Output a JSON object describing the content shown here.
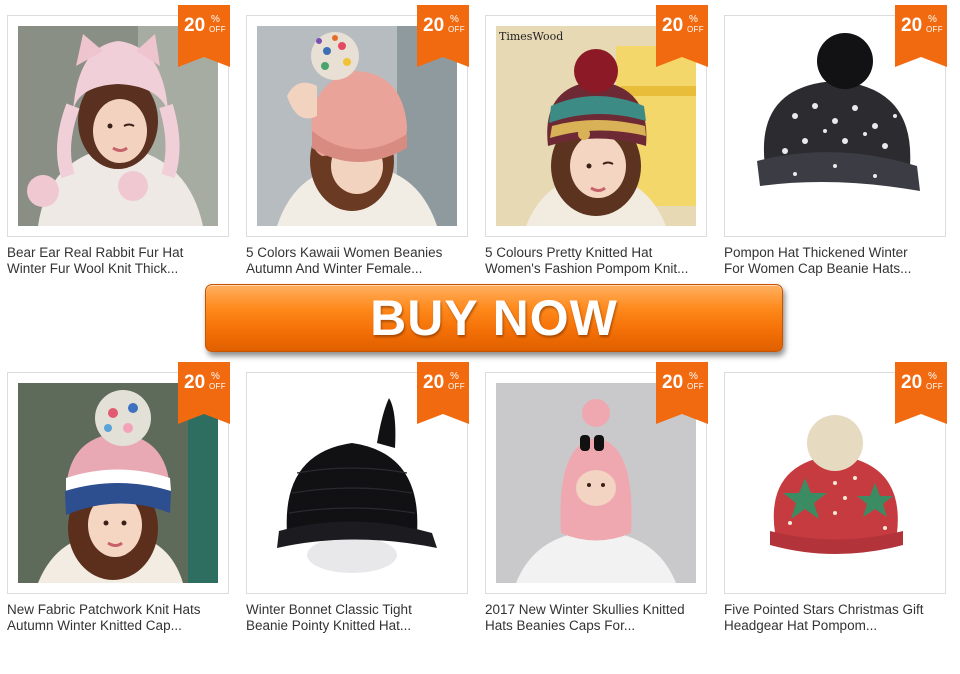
{
  "colors": {
    "badge": "#f26a10",
    "button": "#f37a10",
    "text": "#333333"
  },
  "badge": {
    "number": "20",
    "percent": "%",
    "off": "OFF"
  },
  "buy_button": {
    "label": "BUY NOW"
  },
  "products": [
    {
      "line1": "Bear Ear Real Rabbit Fur Hat",
      "line2": "Winter Fur Wool Knit Thick..."
    },
    {
      "line1": "5 Colors Kawaii Women Beanies",
      "line2": "Autumn And Winter Female..."
    },
    {
      "line1": "5 Colours Pretty Knitted Hat",
      "line2": "Women's Fashion Pompom Knit...",
      "watermark": "TimesWood"
    },
    {
      "line1": "Pompon Hat Thickened Winter",
      "line2": "For Women Cap Beanie Hats..."
    },
    {
      "line1": "New Fabric Patchwork Knit Hats",
      "line2": "Autumn Winter Knitted Cap..."
    },
    {
      "line1": "Winter Bonnet Classic Tight",
      "line2": "Beanie Pointy Knitted Hat..."
    },
    {
      "line1": "2017 New Winter Skullies Knitted",
      "line2": "Hats Beanies Caps For..."
    },
    {
      "line1": "Five Pointed Stars Christmas Gift",
      "line2": "Headgear Hat Pompom..."
    }
  ]
}
